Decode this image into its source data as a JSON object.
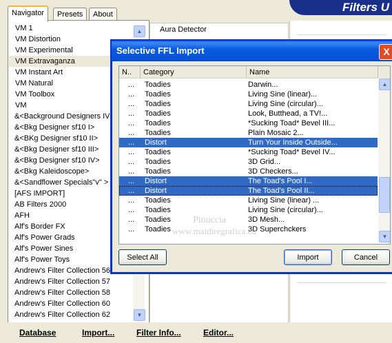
{
  "banner": {
    "title": "Filters U"
  },
  "tabs": [
    {
      "label": "Navigator",
      "active": true
    },
    {
      "label": "Presets",
      "active": false
    },
    {
      "label": "About",
      "active": false
    }
  ],
  "filter_list": {
    "selected_index": 3,
    "items": [
      "VM 1",
      "VM Distortion",
      "VM Experimental",
      "VM Extravaganza",
      "VM Instant Art",
      "VM Natural",
      "VM Toolbox",
      "VM",
      "&<Background Designers IV>",
      "&<Bkg Designer sf10 I>",
      "&<BKg Designer sf10 II>",
      "&<Bkg Designer sf10 III>",
      "&<Bkg Designer sf10 IV>",
      "&<Bkg Kaleidoscope>",
      "&<Sandflower Specials\"v\" >",
      "[AFS IMPORT]",
      "AB Filters 2000",
      "AFH",
      "Alf's Border FX",
      "Alf's Power Grads",
      "Alf's Power Sines",
      "Alf's Power Toys",
      "Andrew's Filter Collection 56",
      "Andrew's Filter Collection 57",
      "Andrew's Filter Collection 58",
      "Andrew's Filter Collection 60",
      "Andrew's Filter Collection 62"
    ]
  },
  "middle_panel": {
    "lines": [
      "Aura Detector"
    ]
  },
  "bottom_menu": {
    "database": "Database",
    "import": "Import...",
    "filter_info": "Filter Info...",
    "editor": "Editor..."
  },
  "dialog": {
    "title": "Selective FFL Import",
    "close": "X",
    "columns": {
      "n": "N..",
      "category": "Category",
      "name": "Name"
    },
    "rows": [
      {
        "n": "...",
        "category": "Toadies",
        "name": "Darwin...",
        "selected": false
      },
      {
        "n": "...",
        "category": "Toadies",
        "name": "Living Sine (linear)...",
        "selected": false
      },
      {
        "n": "...",
        "category": "Toadies",
        "name": "Living Sine (circular)...",
        "selected": false
      },
      {
        "n": "...",
        "category": "Toadies",
        "name": "Look, Butthead, a TV!...",
        "selected": false
      },
      {
        "n": "...",
        "category": "Toadies",
        "name": "*Sucking Toad*  Bevel III...",
        "selected": false
      },
      {
        "n": "...",
        "category": "Toadies",
        "name": "Plain Mosaic 2...",
        "selected": false
      },
      {
        "n": "...",
        "category": "Distort",
        "name": "Turn Your Inside Outside...",
        "selected": true
      },
      {
        "n": "...",
        "category": "Toadies",
        "name": "*Sucking Toad*  Bevel IV...",
        "selected": false
      },
      {
        "n": "...",
        "category": "Toadies",
        "name": "3D Grid...",
        "selected": false
      },
      {
        "n": "...",
        "category": "Toadies",
        "name": "3D Checkers...",
        "selected": false
      },
      {
        "n": "...",
        "category": "Distort",
        "name": "The Toad's Pool I...",
        "selected": true
      },
      {
        "n": "...",
        "category": "Distort",
        "name": "The Toad's Pool II...",
        "selected": true
      },
      {
        "n": "...",
        "category": "Toadies",
        "name": "Living Sine (linear) ...",
        "selected": false
      },
      {
        "n": "...",
        "category": "Toadies",
        "name": "Living Sine (circular)...",
        "selected": false
      },
      {
        "n": "...",
        "category": "Toadies",
        "name": "3D Mesh...",
        "selected": false
      },
      {
        "n": "...",
        "category": "Toadies",
        "name": "3D Superchckers",
        "selected": false
      }
    ],
    "buttons": {
      "select_all": "Select All",
      "import": "Import",
      "cancel": "Cancel"
    },
    "scroll_position": 0.82
  },
  "watermark": {
    "line1": "Pinuccia",
    "line2": "www.maidiregrafica.eu"
  },
  "colors": {
    "selection": "#316ac5",
    "title_bar": "#0a5ce8",
    "banner": "#1a2f8a"
  }
}
